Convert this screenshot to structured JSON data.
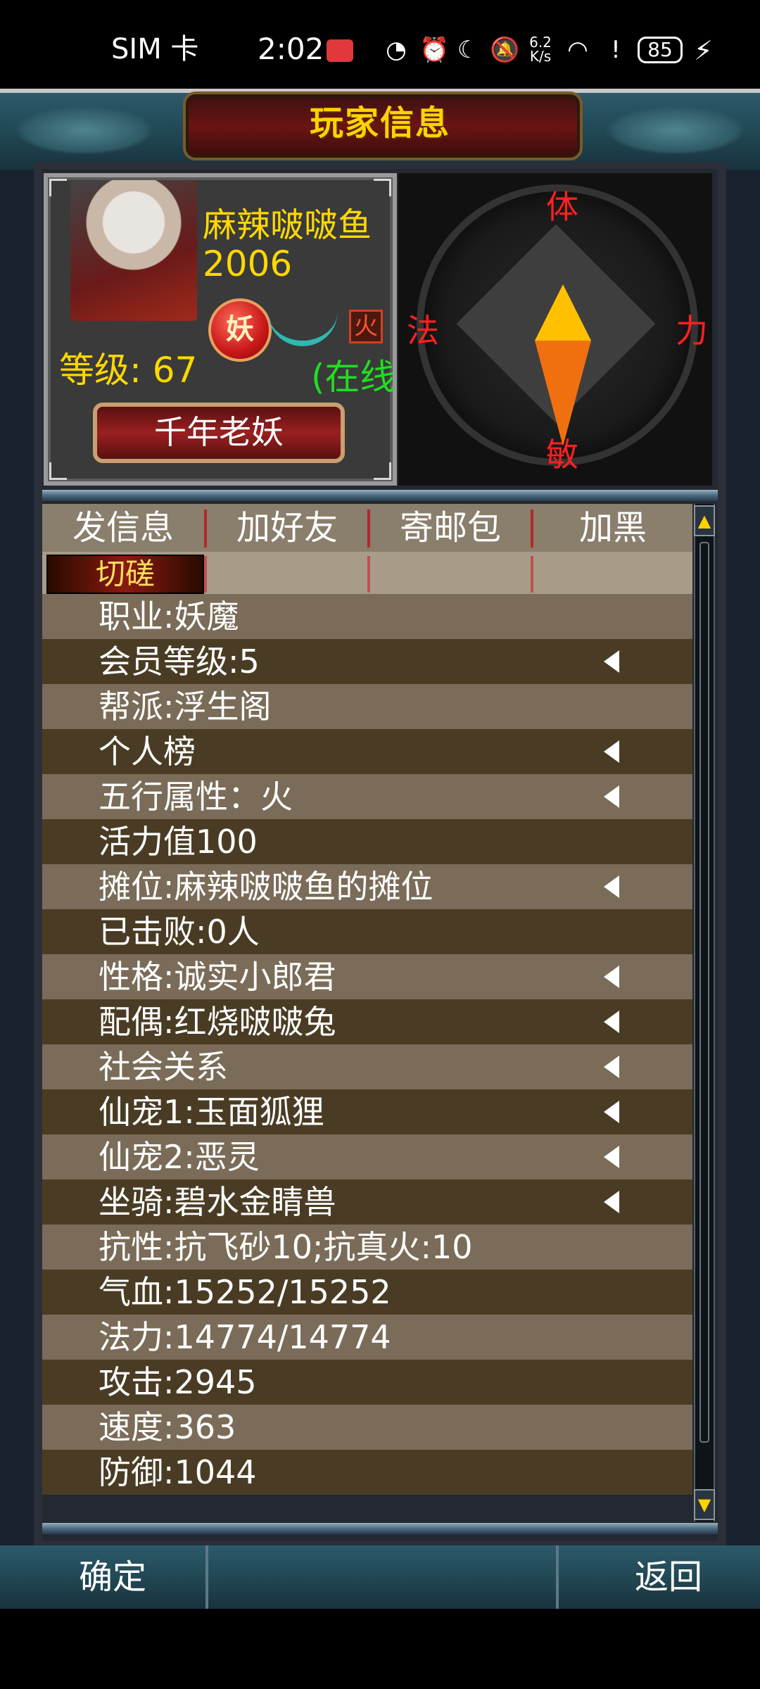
{
  "status_bar": {
    "sim": "SIM 卡",
    "time": "2:02",
    "speed": "6.2 K/s",
    "battery": "85"
  },
  "header": {
    "title": "玩家信息"
  },
  "profile": {
    "name": "麻辣啵啵鱼",
    "id": "2006",
    "race_badge": "妖",
    "element_badge": "火",
    "online": "(在线)",
    "level": "等级: 67",
    "title_plaque": "千年老妖"
  },
  "attributes": {
    "top": "体",
    "left": "法",
    "right": "力",
    "bottom": "敏"
  },
  "actions": [
    {
      "label": "发信息"
    },
    {
      "label": "加好友"
    },
    {
      "label": "寄邮包"
    },
    {
      "label": "加黑"
    }
  ],
  "spar_label": "切磋",
  "info_rows": [
    {
      "text": "职业:妖魔",
      "arrow": false
    },
    {
      "text": "会员等级:5",
      "arrow": true
    },
    {
      "text": "帮派:浮生阁",
      "arrow": false
    },
    {
      "text": "个人榜",
      "arrow": true
    },
    {
      "text": "五行属性：火",
      "arrow": true
    },
    {
      "text": "活力值100",
      "arrow": false
    },
    {
      "text": "摊位:麻辣啵啵鱼的摊位",
      "arrow": true
    },
    {
      "text": "已击败:0人",
      "arrow": false
    },
    {
      "text": "性格:诚实小郎君",
      "arrow": true
    },
    {
      "text": "配偶:红烧啵啵兔",
      "arrow": true
    },
    {
      "text": "社会关系",
      "arrow": true
    },
    {
      "text": "仙宠1:玉面狐狸",
      "arrow": true
    },
    {
      "text": "仙宠2:恶灵",
      "arrow": true
    },
    {
      "text": "坐骑:碧水金睛兽",
      "arrow": true
    },
    {
      "text": "抗性:抗飞砂10;抗真火:10",
      "arrow": false
    },
    {
      "text": "气血:15252/15252",
      "arrow": false
    },
    {
      "text": "法力:14774/14774",
      "arrow": false
    },
    {
      "text": "攻击:2945",
      "arrow": false
    },
    {
      "text": "速度:363",
      "arrow": false
    },
    {
      "text": "防御:1044",
      "arrow": false
    }
  ],
  "footer": {
    "confirm": "确定",
    "back": "返回"
  }
}
